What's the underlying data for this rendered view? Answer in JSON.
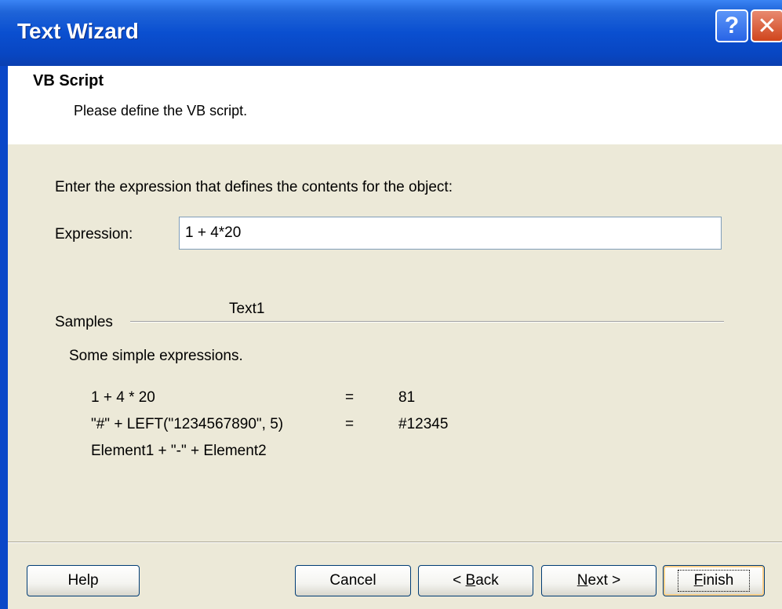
{
  "window": {
    "title": "Text Wizard",
    "help_glyph": "?",
    "close_glyph": "✕",
    "colors": {
      "titlebar": "#0a4fd0",
      "body": "#ece9d8",
      "header": "#ffffff"
    }
  },
  "header": {
    "title": "VB Script",
    "subtitle": "Please define the VB script."
  },
  "form": {
    "instruction": "Enter the expression that defines the contents for the object:",
    "expression_label": "Expression:",
    "expression_value": "1 + 4*20"
  },
  "samples": {
    "label": "Samples",
    "tab_label": "Text1",
    "description": "Some simple expressions.",
    "rows": [
      {
        "expr": "1 + 4 * 20",
        "eq": "=",
        "result": "81"
      },
      {
        "expr": "\"#\" + LEFT(\"1234567890\", 5)",
        "eq": "=",
        "result": "#12345"
      },
      {
        "expr": "Element1 + \"-\" + Element2",
        "eq": "",
        "result": ""
      }
    ]
  },
  "buttons": {
    "help": "Help",
    "cancel": "Cancel",
    "back_prefix": "< ",
    "back_accel": "B",
    "back_rest": "ack",
    "next_accel": "N",
    "next_rest": "ext >",
    "finish_accel": "F",
    "finish_rest": "inish"
  }
}
